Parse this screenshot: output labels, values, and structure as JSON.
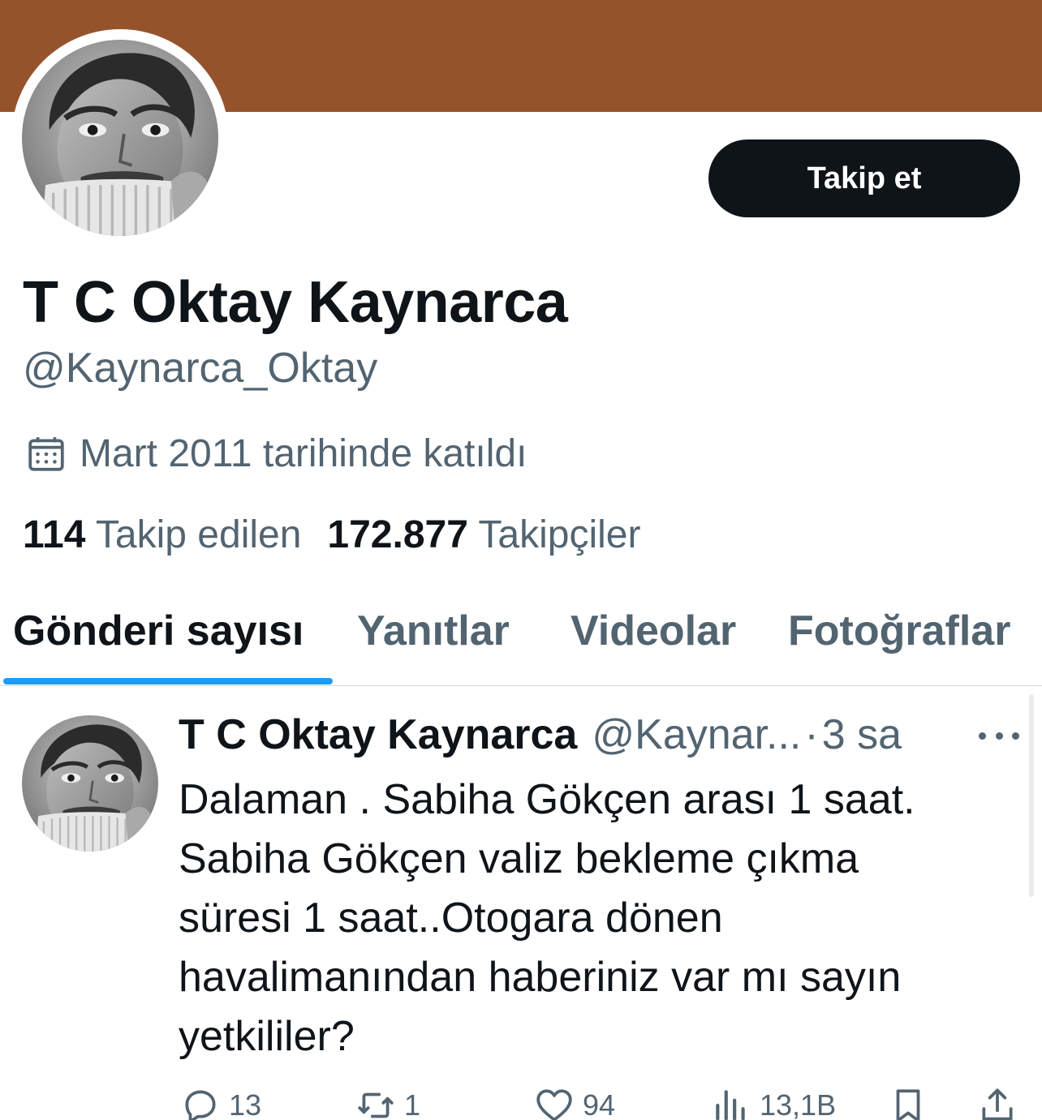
{
  "profile": {
    "banner_color": "#95532c",
    "avatar_icon": "profile-photo",
    "display_name": "T C Oktay Kaynarca",
    "handle": "@Kaynarca_Oktay",
    "follow_label": "Takip et",
    "joined_icon": "calendar-icon",
    "joined_text": "Mart 2011 tarihinde katıldı",
    "following_count": "114",
    "following_label": "Takip edilen",
    "followers_count": "172.877",
    "followers_label": "Takipçiler"
  },
  "tabs": [
    {
      "label": "Gönderi sayısı",
      "active": true
    },
    {
      "label": "Yanıtlar",
      "active": false
    },
    {
      "label": "Videolar",
      "active": false
    },
    {
      "label": "Fotoğraflar",
      "active": false
    }
  ],
  "accent_color": "#1d9bf0",
  "post": {
    "author_name": "T C Oktay Kaynarca",
    "author_handle": "@Kaynar...",
    "separator": "·",
    "time": "3 sa",
    "text": "Dalaman . Sabiha Gökçen arası 1 saat.\nSabiha Gökçen valiz bekleme çıkma\nsüresi 1 saat..Otogara dönen\nhavalimanından haberiniz var mı sayın\nyetkililer?",
    "actions": {
      "reply": {
        "icon": "reply-icon",
        "count": "13"
      },
      "repost": {
        "icon": "repost-icon",
        "count": "1"
      },
      "like": {
        "icon": "heart-icon",
        "count": "94"
      },
      "views": {
        "icon": "views-icon",
        "count": "13,1B"
      },
      "bookmark": {
        "icon": "bookmark-icon"
      },
      "share": {
        "icon": "share-icon"
      }
    }
  }
}
